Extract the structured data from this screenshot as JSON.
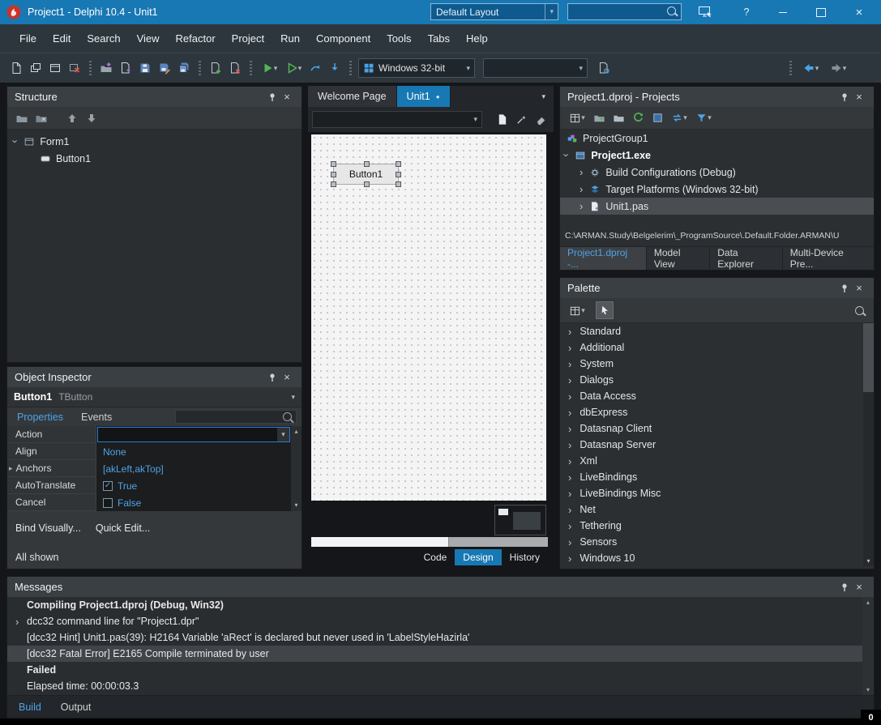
{
  "icons": {
    "chevron_down": "▾",
    "chevron_right": "▸",
    "thin_chevron": "›",
    "dot": "●",
    "close": "×",
    "help": "?",
    "check": "✓",
    "up_small": "▴",
    "down_small": "▾"
  },
  "titlebar": {
    "title": "Project1 - Delphi 10.4 - Unit1",
    "layout_combo": "Default Layout",
    "search_value": ""
  },
  "menus": [
    "File",
    "Edit",
    "Search",
    "View",
    "Refactor",
    "Project",
    "Run",
    "Component",
    "Tools",
    "Tabs",
    "Help"
  ],
  "toolbar": {
    "platform_combo": "Windows 32-bit",
    "config_combo": ""
  },
  "structure": {
    "title": "Structure",
    "tree": [
      {
        "label": "Form1"
      },
      {
        "label": "Button1"
      }
    ]
  },
  "object_inspector": {
    "title": "Object Inspector",
    "component": "Button1",
    "component_type": "TButton",
    "tabs": [
      "Properties",
      "Events"
    ],
    "properties": [
      {
        "name": "Action",
        "value": ""
      },
      {
        "name": "Align",
        "value": "None"
      },
      {
        "name": "Anchors",
        "value": "[akLeft,akTop]"
      },
      {
        "name": "AutoTranslate",
        "value": "True"
      },
      {
        "name": "Cancel",
        "value": "False"
      }
    ],
    "links": [
      "Bind Visually...",
      "Quick Edit..."
    ],
    "footer": "All shown"
  },
  "editor": {
    "tabs": [
      "Welcome Page",
      "Unit1"
    ],
    "designer_button": "Button1",
    "bottom_tabs": [
      "Code",
      "Design",
      "History"
    ]
  },
  "projects": {
    "title": "Project1.dproj - Projects",
    "tree": [
      {
        "label": "ProjectGroup1"
      },
      {
        "label": "Project1.exe"
      },
      {
        "label": "Build Configurations (Debug)"
      },
      {
        "label": "Target Platforms (Windows 32-bit)"
      },
      {
        "label": "Unit1.pas"
      }
    ],
    "path": "C:\\ARMAN.Study\\Belgelerim\\_ProgramSource\\.Default.Folder.ARMAN\\U",
    "tabs": [
      "Project1.dproj -...",
      "Model View",
      "Data Explorer",
      "Multi-Device Pre..."
    ]
  },
  "palette": {
    "title": "Palette",
    "categories": [
      "Standard",
      "Additional",
      "System",
      "Dialogs",
      "Data Access",
      "dbExpress",
      "Datasnap Client",
      "Datasnap Server",
      "Xml",
      "LiveBindings",
      "LiveBindings Misc",
      "Net",
      "Tethering",
      "Sensors",
      "Windows 10"
    ]
  },
  "messages": {
    "title": "Messages",
    "lines": [
      "Compiling Project1.dproj (Debug, Win32)",
      "dcc32 command line for \"Project1.dpr\"",
      "[dcc32 Hint] Unit1.pas(39): H2164 Variable 'aRect' is declared but never used in 'LabelStyleHazirla'",
      "[dcc32 Fatal Error] E2165 Compile terminated by user",
      "Failed",
      "Elapsed time: 00:00:03.3"
    ],
    "tabs": [
      "Build",
      "Output"
    ]
  },
  "badge": "0"
}
